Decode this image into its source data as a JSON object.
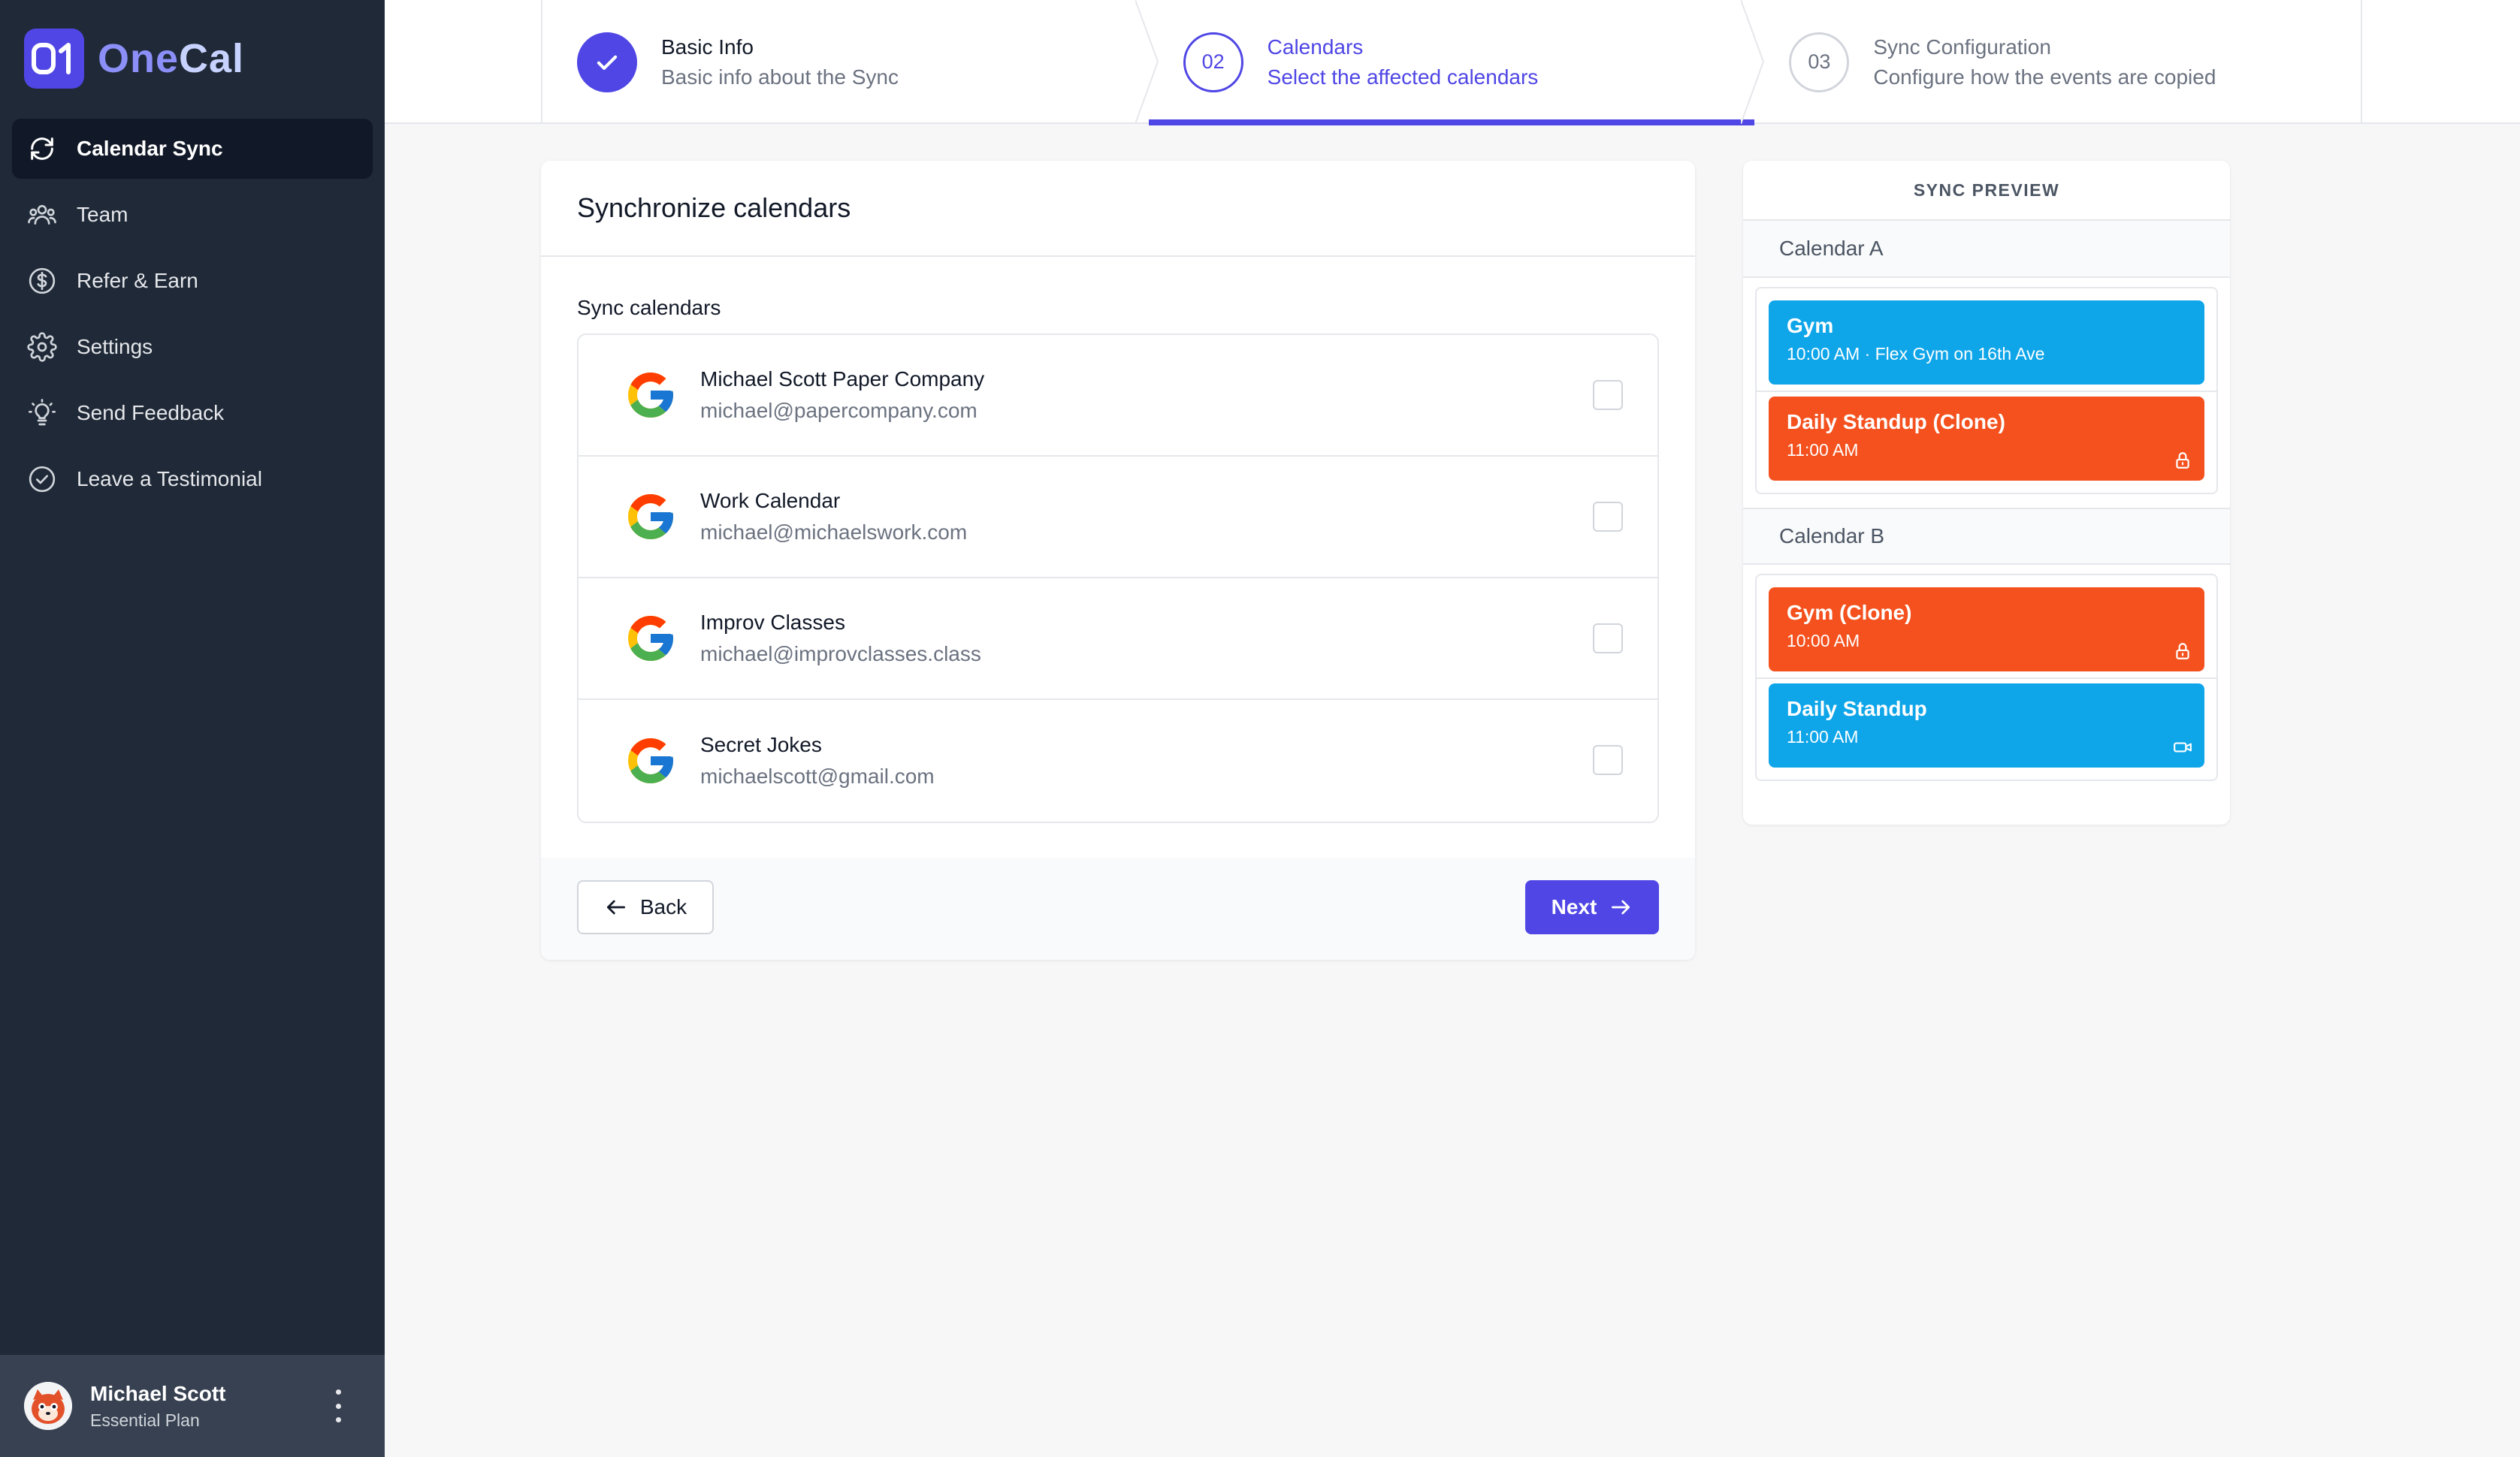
{
  "app": {
    "logo_mark": "01",
    "logo_name_part1": "One",
    "logo_name_part2": "Cal"
  },
  "sidebar": {
    "items": [
      {
        "label": "Calendar Sync",
        "icon": "sync-icon",
        "active": true
      },
      {
        "label": "Team",
        "icon": "team-icon",
        "active": false
      },
      {
        "label": "Refer & Earn",
        "icon": "dollar-icon",
        "active": false
      },
      {
        "label": "Settings",
        "icon": "gear-icon",
        "active": false
      },
      {
        "label": "Send Feedback",
        "icon": "lightbulb-icon",
        "active": false
      },
      {
        "label": "Leave a Testimonial",
        "icon": "check-circle-icon",
        "active": false
      }
    ]
  },
  "user": {
    "name": "Michael Scott",
    "plan": "Essential Plan"
  },
  "stepper": {
    "steps": [
      {
        "number": "",
        "title": "Basic Info",
        "subtitle": "Basic info about the Sync",
        "state": "done"
      },
      {
        "number": "02",
        "title": "Calendars",
        "subtitle": "Select the affected calendars",
        "state": "current"
      },
      {
        "number": "03",
        "title": "Sync Configuration",
        "subtitle": "Configure how the events are copied",
        "state": "upcoming"
      }
    ]
  },
  "main": {
    "title": "Synchronize calendars",
    "section_label": "Sync calendars",
    "calendars": [
      {
        "name": "Michael Scott Paper Company",
        "email": "michael@papercompany.com",
        "checked": false
      },
      {
        "name": "Work Calendar",
        "email": "michael@michaelswork.com",
        "checked": false
      },
      {
        "name": "Improv Classes",
        "email": "michael@improvclasses.class",
        "checked": false
      },
      {
        "name": "Secret Jokes",
        "email": "michaelscott@gmail.com",
        "checked": false
      }
    ],
    "back_label": "Back",
    "next_label": "Next"
  },
  "preview": {
    "heading": "SYNC PREVIEW",
    "calendar_a": {
      "label": "Calendar A",
      "events": [
        {
          "title": "Gym",
          "subtitle": "10:00 AM · Flex Gym on 16th Ave",
          "color": "#0ea5e9",
          "icon": ""
        },
        {
          "title": "Daily Standup (Clone)",
          "subtitle": "11:00 AM",
          "color": "#f4511e",
          "icon": "lock-icon"
        }
      ]
    },
    "calendar_b": {
      "label": "Calendar B",
      "events": [
        {
          "title": "Gym (Clone)",
          "subtitle": "10:00 AM",
          "color": "#f4511e",
          "icon": "lock-icon"
        },
        {
          "title": "Daily Standup",
          "subtitle": "11:00 AM",
          "color": "#0ea5e9",
          "icon": "video-icon"
        }
      ]
    }
  },
  "colors": {
    "accent": "#4f46e5",
    "sidebar_bg": "#1f2937",
    "event_blue": "#0ea5e9",
    "event_orange": "#f4511e"
  }
}
